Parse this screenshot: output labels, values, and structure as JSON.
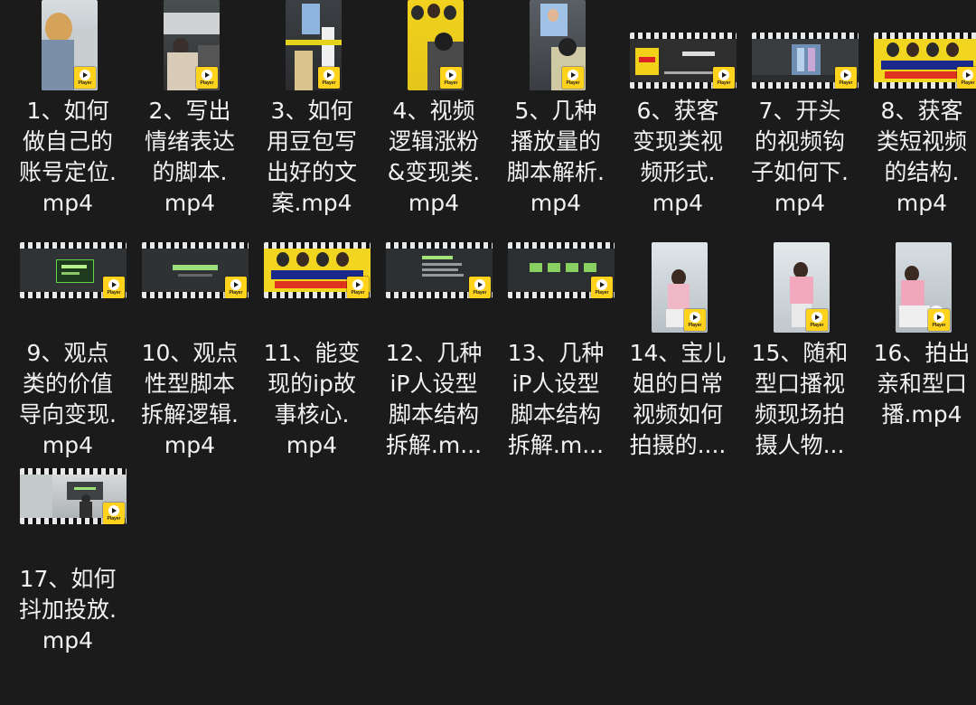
{
  "files": [
    {
      "lines": [
        "1、如何",
        "做自己的",
        "账号定位.",
        "mp4"
      ],
      "thumb": "portrait",
      "scene": "office-woman",
      "badge": "Player"
    },
    {
      "lines": [
        "2、写出",
        "情绪表达",
        "的脚本.",
        "mp4"
      ],
      "thumb": "portrait",
      "scene": "classroom",
      "badge": "Player"
    },
    {
      "lines": [
        "3、如何",
        "用豆包写",
        "出好的文",
        "案.mp4"
      ],
      "thumb": "portrait",
      "scene": "presenter-phone",
      "badge": "Player"
    },
    {
      "lines": [
        "4、视频",
        "逻辑涨粉",
        "&变现类.",
        "mp4"
      ],
      "thumb": "portrait",
      "scene": "poster-audience",
      "badge": "Player"
    },
    {
      "lines": [
        "5、几种",
        "播放量的",
        "脚本解析.",
        "mp4"
      ],
      "thumb": "portrait",
      "scene": "screen-audience",
      "badge": "Player"
    },
    {
      "lines": [
        "6、获客",
        "变现类视",
        "频形式.",
        "mp4"
      ],
      "thumb": "landscape",
      "scene": "slide-yellow",
      "badge": "Player"
    },
    {
      "lines": [
        "7、开头",
        "的视频钩",
        "子如何下.",
        "mp4"
      ],
      "thumb": "landscape",
      "scene": "slide-phones",
      "badge": "Player"
    },
    {
      "lines": [
        "8、获客",
        "类短视频",
        "的结构.",
        "mp4"
      ],
      "thumb": "landscape",
      "scene": "poster-people",
      "badge": "Player"
    },
    {
      "lines": [
        "9、观点",
        "类的价值",
        "导向变现.",
        "mp4"
      ],
      "thumb": "landscape",
      "scene": "slide-dark-green",
      "badge": "Player"
    },
    {
      "lines": [
        "10、观点",
        "性型脚本",
        "拆解逻辑.",
        "mp4"
      ],
      "thumb": "landscape",
      "scene": "slide-dark-title",
      "badge": "Player"
    },
    {
      "lines": [
        "11、能变",
        "现的ip故",
        "事核心.",
        "mp4"
      ],
      "thumb": "landscape",
      "scene": "poster-people",
      "badge": "Player"
    },
    {
      "lines": [
        "12、几种",
        "iP人设型",
        "脚本结构",
        "拆解.m..."
      ],
      "thumb": "landscape",
      "scene": "slide-dark-list",
      "badge": "Player"
    },
    {
      "lines": [
        "13、几种",
        "iP人设型",
        "脚本结构",
        "拆解.m..."
      ],
      "thumb": "landscape",
      "scene": "slide-dark-boxes",
      "badge": "Player"
    },
    {
      "lines": [
        "14、宝儿",
        "姐的日常",
        "视频如何",
        "拍摄的...."
      ],
      "thumb": "portrait",
      "scene": "woman-sitting",
      "badge": "Player"
    },
    {
      "lines": [
        "15、随和",
        "型口播视",
        "频现场拍",
        "摄人物..."
      ],
      "thumb": "portrait",
      "scene": "woman-standing",
      "badge": "Player"
    },
    {
      "lines": [
        "16、拍出",
        "亲和型口",
        "播.mp4"
      ],
      "thumb": "portrait",
      "scene": "woman-crouch",
      "badge": "Player"
    },
    {
      "lines": [
        "17、如何",
        "抖加投放.",
        "mp4"
      ],
      "thumb": "landscape",
      "scene": "room-man",
      "badge": "Player"
    }
  ],
  "colors": {
    "background": "#1b1b1b",
    "text": "#f2f2f2",
    "badge": "#ffd21c"
  }
}
